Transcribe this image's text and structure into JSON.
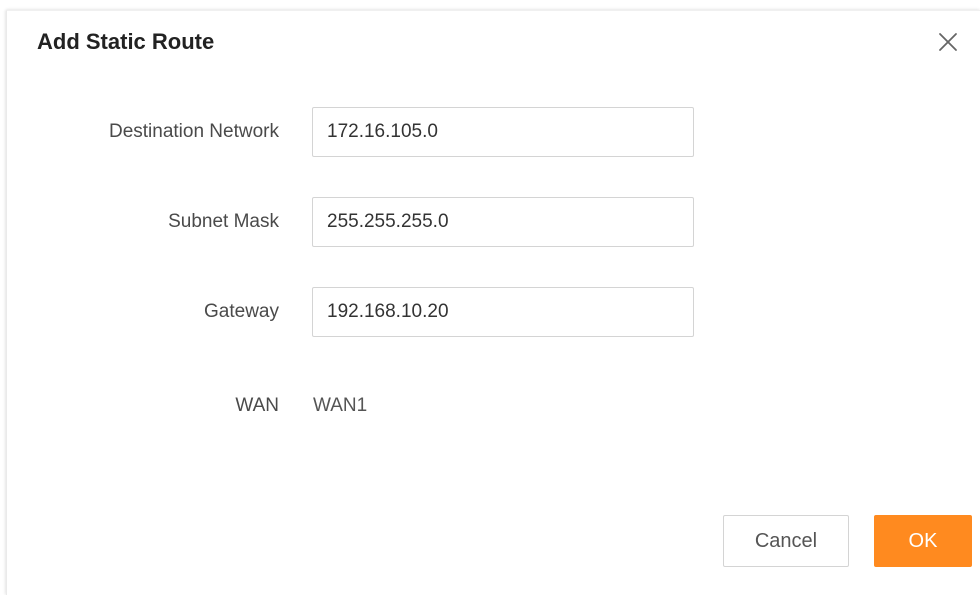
{
  "dialog": {
    "title": "Add Static Route",
    "close_icon": "close-icon"
  },
  "form": {
    "destination_network": {
      "label": "Destination Network",
      "value": "172.16.105.0"
    },
    "subnet_mask": {
      "label": "Subnet Mask",
      "value": "255.255.255.0"
    },
    "gateway": {
      "label": "Gateway",
      "value": "192.168.10.20"
    },
    "wan": {
      "label": "WAN",
      "value": "WAN1"
    }
  },
  "buttons": {
    "cancel_label": "Cancel",
    "ok_label": "OK"
  },
  "colors": {
    "primary": "#ff8a1f",
    "text": "#4a4a4a",
    "border": "#d4d4d4"
  }
}
